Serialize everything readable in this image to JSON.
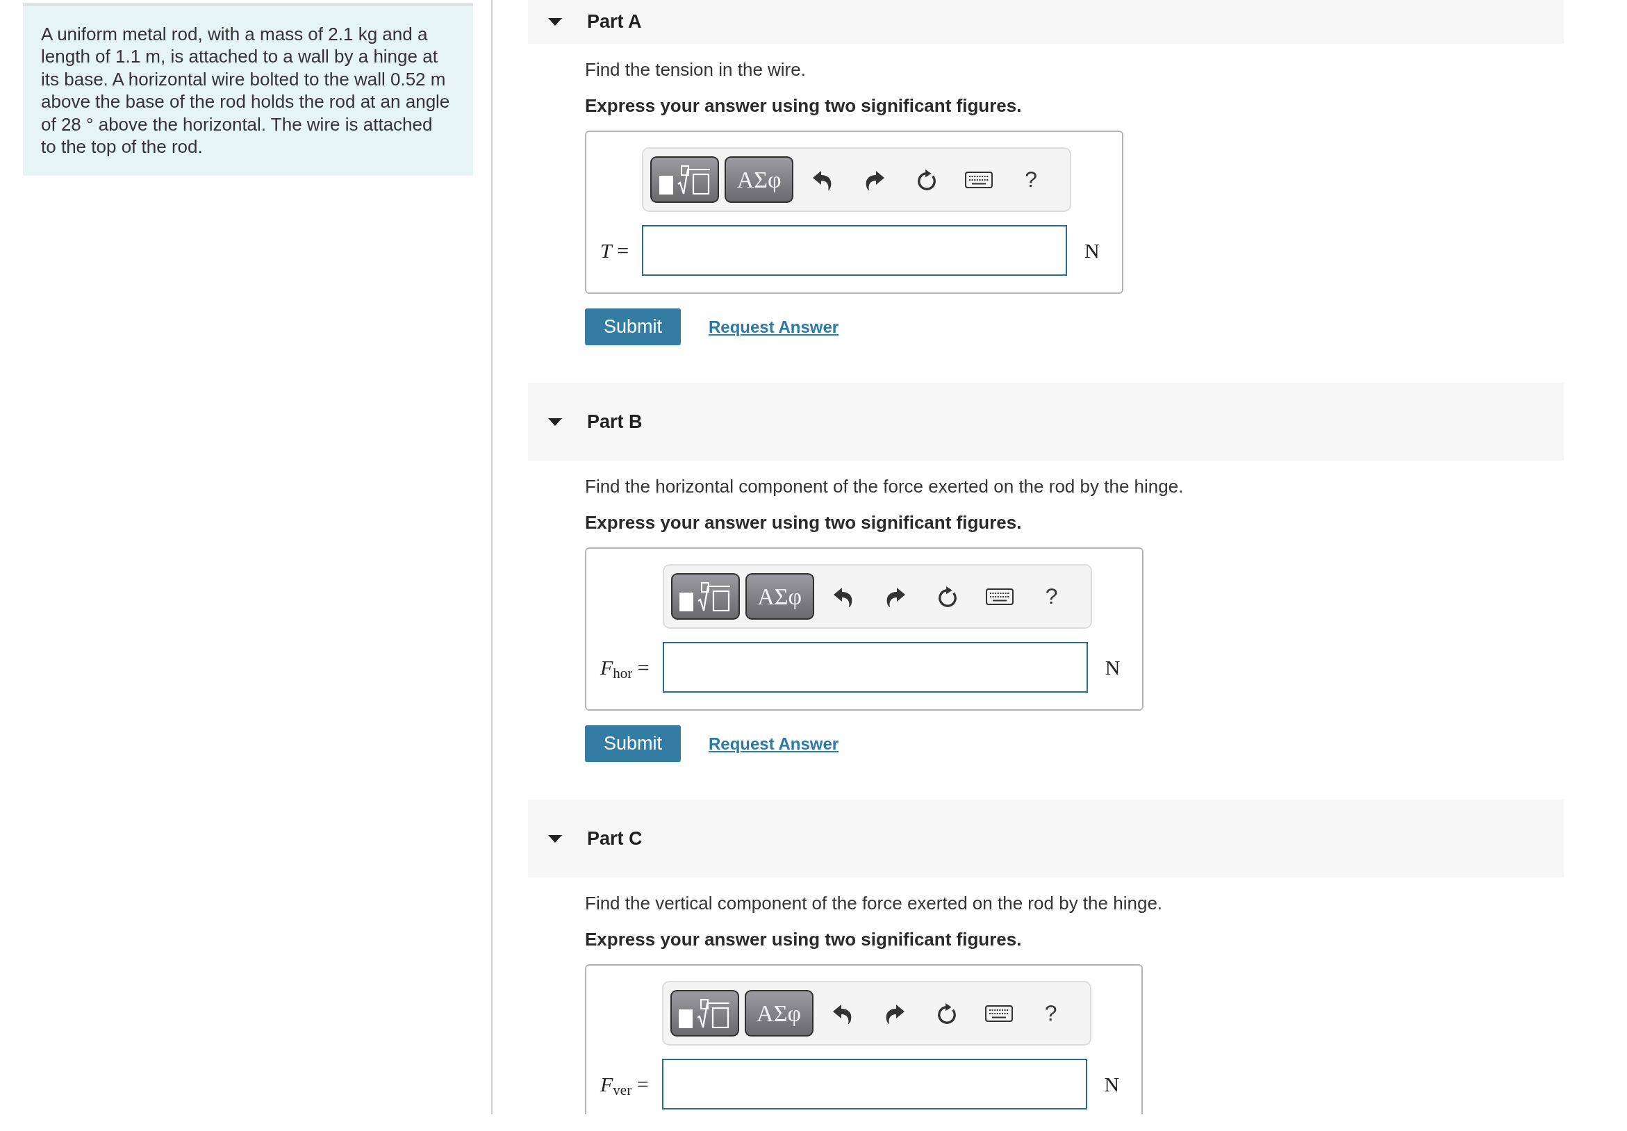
{
  "problem": {
    "text": "A uniform metal rod, with a mass of 2.1 kg and a length of 1.1 m, is attached to a wall by a hinge at its base. A horizontal wire bolted to the wall 0.52 m above the base of the rod holds the rod at an angle of 28 ° above the horizontal. The wire is attached to the top of the rod."
  },
  "parts": [
    {
      "title": "Part A",
      "expanded": true,
      "question": "Find the tension in the wire.",
      "instruction": "Express your answer using two significant figures.",
      "answer": {
        "toolbar": {
          "greek_button": "ΑΣφ",
          "help_button": "?"
        },
        "label": "*T* =",
        "unit": "N"
      },
      "actions": {
        "submit": "Submit",
        "request_answer": "Request Answer"
      }
    },
    {
      "title": "Part B",
      "expanded": true,
      "question": "Find the horizontal component of the force exerted on the rod by the hinge.",
      "instruction": "Express your answer using two significant figures.",
      "answer": {
        "toolbar": {
          "greek_button": "ΑΣφ",
          "help_button": "?"
        },
        "label": "*F*$_{hor}$ =",
        "unit": "N"
      },
      "actions": {
        "submit": "Submit",
        "request_answer": "Request Answer"
      }
    },
    {
      "title": "Part C",
      "expanded": true,
      "question": "Find the vertical component of the force exerted on the rod by the hinge.",
      "instruction": "Express your answer using two significant figures.",
      "answer": {
        "toolbar": {
          "greek_button": "ΑΣφ",
          "help_button": "?"
        },
        "label": "*F*$_{ver}$ =",
        "unit": "N"
      }
    }
  ]
}
